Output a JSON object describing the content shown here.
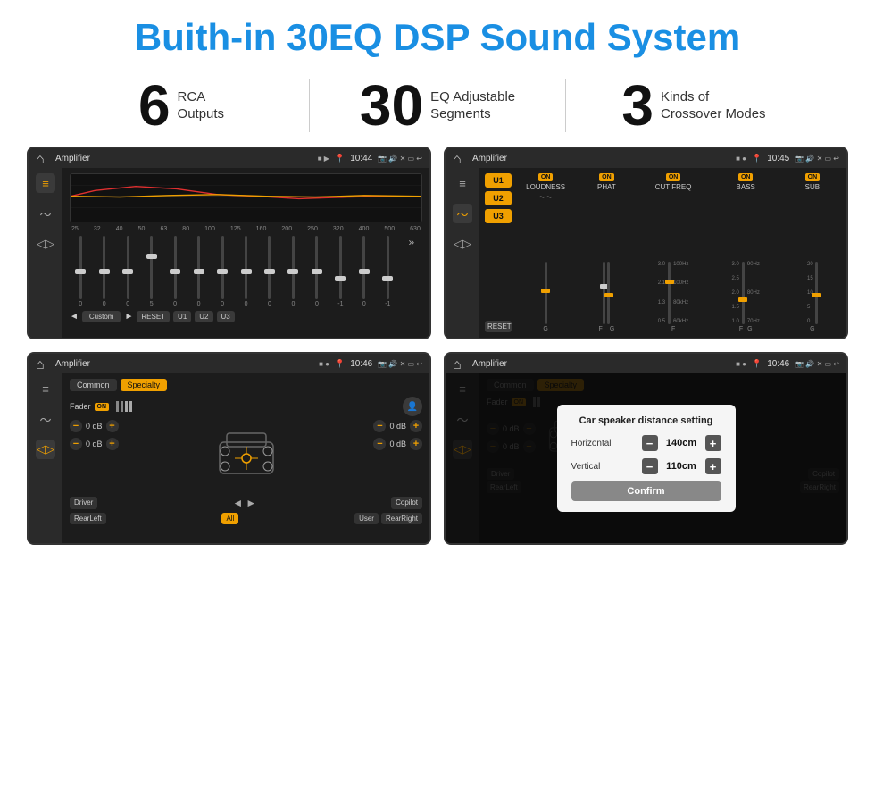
{
  "header": {
    "title": "Buith-in 30EQ DSP Sound System"
  },
  "stats": [
    {
      "number": "6",
      "label": "RCA\nOutputs"
    },
    {
      "number": "30",
      "label": "EQ Adjustable\nSegments"
    },
    {
      "number": "3",
      "label": "Kinds of\nCrossover Modes"
    }
  ],
  "screens": [
    {
      "id": "eq-screen",
      "statusBar": {
        "title": "Amplifier",
        "time": "10:44"
      }
    },
    {
      "id": "crossover-screen",
      "statusBar": {
        "title": "Amplifier",
        "time": "10:45"
      }
    },
    {
      "id": "fader-screen",
      "statusBar": {
        "title": "Amplifier",
        "time": "10:46"
      }
    },
    {
      "id": "distance-screen",
      "statusBar": {
        "title": "Amplifier",
        "time": "10:46"
      },
      "dialog": {
        "title": "Car speaker distance setting",
        "horizontal_label": "Horizontal",
        "horizontal_value": "140cm",
        "vertical_label": "Vertical",
        "vertical_value": "110cm",
        "confirm_label": "Confirm"
      }
    }
  ],
  "eq": {
    "frequencies": [
      "25",
      "32",
      "40",
      "50",
      "63",
      "80",
      "100",
      "125",
      "160",
      "200",
      "250",
      "320",
      "400",
      "500",
      "630"
    ],
    "values": [
      "0",
      "0",
      "0",
      "5",
      "0",
      "0",
      "0",
      "0",
      "0",
      "0",
      "0",
      "-1",
      "0",
      "-1"
    ],
    "buttons": [
      "Custom",
      "RESET",
      "U1",
      "U2",
      "U3"
    ]
  },
  "crossover": {
    "presets": [
      "U1",
      "U2",
      "U3"
    ],
    "sections": [
      {
        "toggle": "ON",
        "label": "LOUDNESS"
      },
      {
        "toggle": "ON",
        "label": "PHAT"
      },
      {
        "toggle": "ON",
        "label": "CUT FREQ"
      },
      {
        "toggle": "ON",
        "label": "BASS"
      },
      {
        "toggle": "ON",
        "label": "SUB"
      }
    ]
  },
  "fader": {
    "tabs": [
      "Common",
      "Specialty"
    ],
    "fader_label": "Fader",
    "fader_toggle": "ON",
    "db_values": [
      "0 dB",
      "0 dB",
      "0 dB",
      "0 dB"
    ],
    "position_labels": [
      "Driver",
      "RearLeft",
      "All",
      "User",
      "Copilot",
      "RearRight"
    ]
  },
  "distance_dialog": {
    "title": "Car speaker distance setting",
    "horizontal_label": "Horizontal",
    "horizontal_value": "140cm",
    "vertical_label": "Vertical",
    "vertical_value": "110cm",
    "confirm_label": "Confirm"
  }
}
